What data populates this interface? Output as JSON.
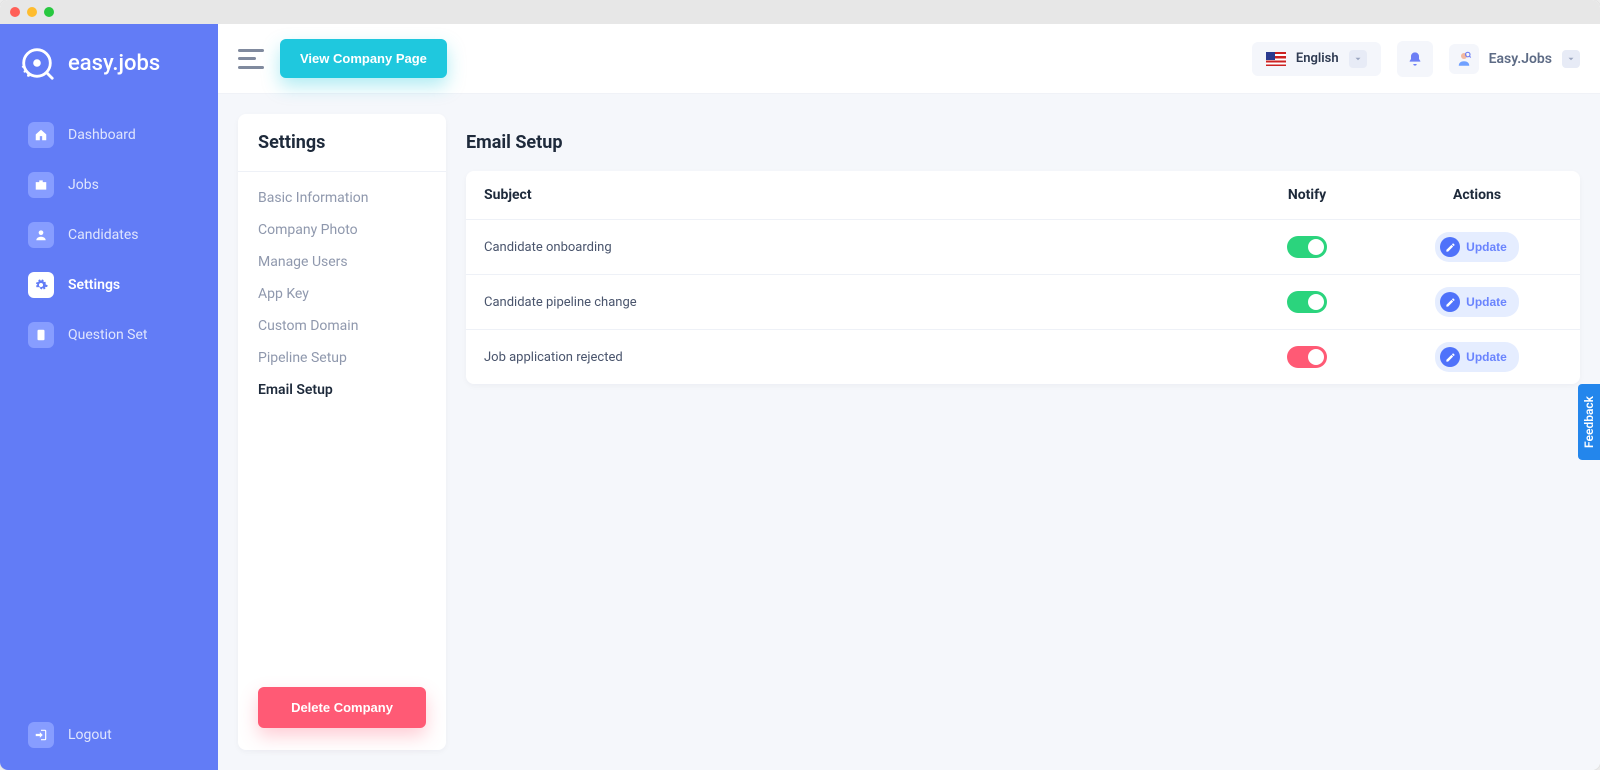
{
  "brand": "easy.jobs",
  "nav": [
    {
      "label": "Dashboard",
      "icon": "home"
    },
    {
      "label": "Jobs",
      "icon": "briefcase"
    },
    {
      "label": "Candidates",
      "icon": "user"
    },
    {
      "label": "Settings",
      "icon": "gear",
      "active": true
    },
    {
      "label": "Question Set",
      "icon": "clipboard"
    }
  ],
  "logout_label": "Logout",
  "topbar": {
    "view_company_label": "View Company Page",
    "language_label": "English",
    "user_name": "Easy.Jobs"
  },
  "settings_panel": {
    "title": "Settings",
    "items": [
      {
        "label": "Basic Information"
      },
      {
        "label": "Company Photo"
      },
      {
        "label": "Manage Users"
      },
      {
        "label": "App Key"
      },
      {
        "label": "Custom Domain"
      },
      {
        "label": "Pipeline Setup"
      },
      {
        "label": "Email Setup",
        "active": true
      }
    ],
    "delete_label": "Delete Company"
  },
  "email_setup": {
    "title": "Email Setup",
    "columns": {
      "subject": "Subject",
      "notify": "Notify",
      "actions": "Actions"
    },
    "update_label": "Update",
    "rows": [
      {
        "subject": "Candidate onboarding",
        "notify": true
      },
      {
        "subject": "Candidate pipeline change",
        "notify": true
      },
      {
        "subject": "Job application rejected",
        "notify": false
      }
    ]
  },
  "feedback_label": "Feedback"
}
